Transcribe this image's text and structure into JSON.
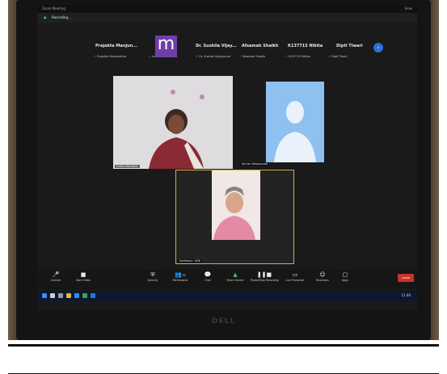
{
  "window": {
    "title": "Zoom Meeting",
    "recording": "Recording...",
    "view": "View"
  },
  "thumbnail_strip": [
    {
      "name": "Prajakta Manjun...",
      "sub": "Prajakta Manjunatha"
    },
    {
      "name": "",
      "sub": "madhuri maharao",
      "avatar_letter": "m"
    },
    {
      "name": "Dr. Sushila Vijay...",
      "sub": "Dr. Sushila Vijaykumar"
    },
    {
      "name": "Afsamah Shaikh",
      "sub": "Afsamah Shaikh"
    },
    {
      "name": "K137715 Nikita",
      "sub": "K137715 Nikita"
    },
    {
      "name": "Dipti Tiwari",
      "sub": "Dipti Tiwari"
    }
  ],
  "strip_next_icon": "chevron-right-icon",
  "video_tiles": [
    {
      "label": "Hutha Deodhar"
    },
    {
      "label": "Kumar Deshpande"
    },
    {
      "label": "Sadhana r AGE"
    }
  ],
  "toolbar": {
    "items": [
      {
        "label": "Unmute",
        "icon": "microphone-muted-icon"
      },
      {
        "label": "Start Video",
        "icon": "video-off-icon"
      },
      {
        "label": "Security",
        "icon": "shield-icon"
      },
      {
        "label": "Participants",
        "icon": "participants-icon",
        "count": "79"
      },
      {
        "label": "Chat",
        "icon": "chat-icon"
      },
      {
        "label": "Share Screen",
        "icon": "share-screen-icon"
      },
      {
        "label": "Pause/Stop Recording",
        "icon": "recording-icon"
      },
      {
        "label": "Live Transcript",
        "icon": "cc-icon"
      },
      {
        "label": "Reactions",
        "icon": "smile-icon"
      },
      {
        "label": "Apps",
        "icon": "apps-icon"
      }
    ],
    "end_label": "Leave"
  },
  "taskbar": {
    "clock": "11:46"
  },
  "monitor_brand": "DELL",
  "colors": {
    "zoom_blue": "#2b6fd6",
    "end_red": "#c9312b",
    "avatar_purple": "#6f3fa8",
    "placeholder_blue": "#8ec0f0"
  }
}
